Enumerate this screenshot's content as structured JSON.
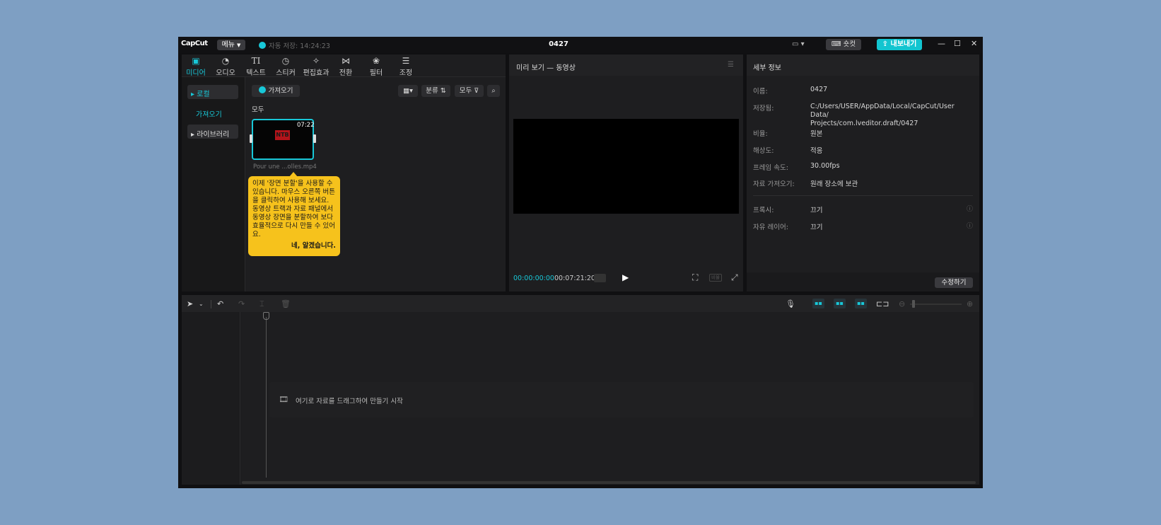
{
  "app": {
    "logo": "CapCut",
    "menu_label": "메뉴",
    "autosave": "자동 저장: 14:24:23",
    "title": "0427",
    "shortcut_label": "숏컷",
    "export_label": "내보내기"
  },
  "media_tabs": [
    {
      "label": "미디어",
      "icon": "media-icon",
      "active": true
    },
    {
      "label": "오디오",
      "icon": "audio-icon",
      "active": false
    },
    {
      "label": "텍스트",
      "icon": "text-icon",
      "active": false
    },
    {
      "label": "스티커",
      "icon": "sticker-icon",
      "active": false
    },
    {
      "label": "편집효과",
      "icon": "effects-icon",
      "active": false
    },
    {
      "label": "전환",
      "icon": "transition-icon",
      "active": false
    },
    {
      "label": "필터",
      "icon": "filter-icon",
      "active": false
    },
    {
      "label": "조정",
      "icon": "adjust-icon",
      "active": false
    }
  ],
  "sidebar": {
    "local": "로컬",
    "import": "가져오기",
    "library": "라이브러리"
  },
  "media": {
    "import_button": "가져오기",
    "sort_label": "분류",
    "filter_label": "모두",
    "section_label": "모두",
    "clip": {
      "duration": "07:22",
      "filename": "Pour une ...olles.mp4",
      "thumb_text": "NTB"
    }
  },
  "tooltip": {
    "text": "이제 '장면 분할'을 사용할 수 있습니다. 마우스 오른쪽 버튼을 클릭하여 사용해 보세요. 동영상 트랙과 자료 패널에서 동영상 장면을 분할하여 보다 효율적으로 다시 만들 수 있어요.",
    "confirm": "네, 알겠습니다."
  },
  "preview": {
    "title": "미리 보기 — 동영상",
    "time_current": "00:00:00:00",
    "time_total": "00:07:21:20",
    "ratio_label": "비율"
  },
  "details": {
    "title": "세부 정보",
    "rows": [
      {
        "label": "이름:",
        "value": "0427"
      },
      {
        "label": "저장됨:",
        "value": "C:/Users/USER/AppData/Local/CapCut/User Data/\nProjects/com.lveditor.draft/0427"
      },
      {
        "label": "비율:",
        "value": "원본"
      },
      {
        "label": "해상도:",
        "value": "적응"
      },
      {
        "label": "프레임 속도:",
        "value": "30.00fps"
      },
      {
        "label": "자료 가져오기:",
        "value": "원래 장소에 보관"
      }
    ],
    "proxy_label": "프록시:",
    "proxy_value": "끄기",
    "free_layer_label": "자유 레이어:",
    "free_layer_value": "끄기",
    "edit_button": "수정하기"
  },
  "timeline": {
    "drop_hint": "여기로 자료를 드래그하여 만들기 시작"
  }
}
